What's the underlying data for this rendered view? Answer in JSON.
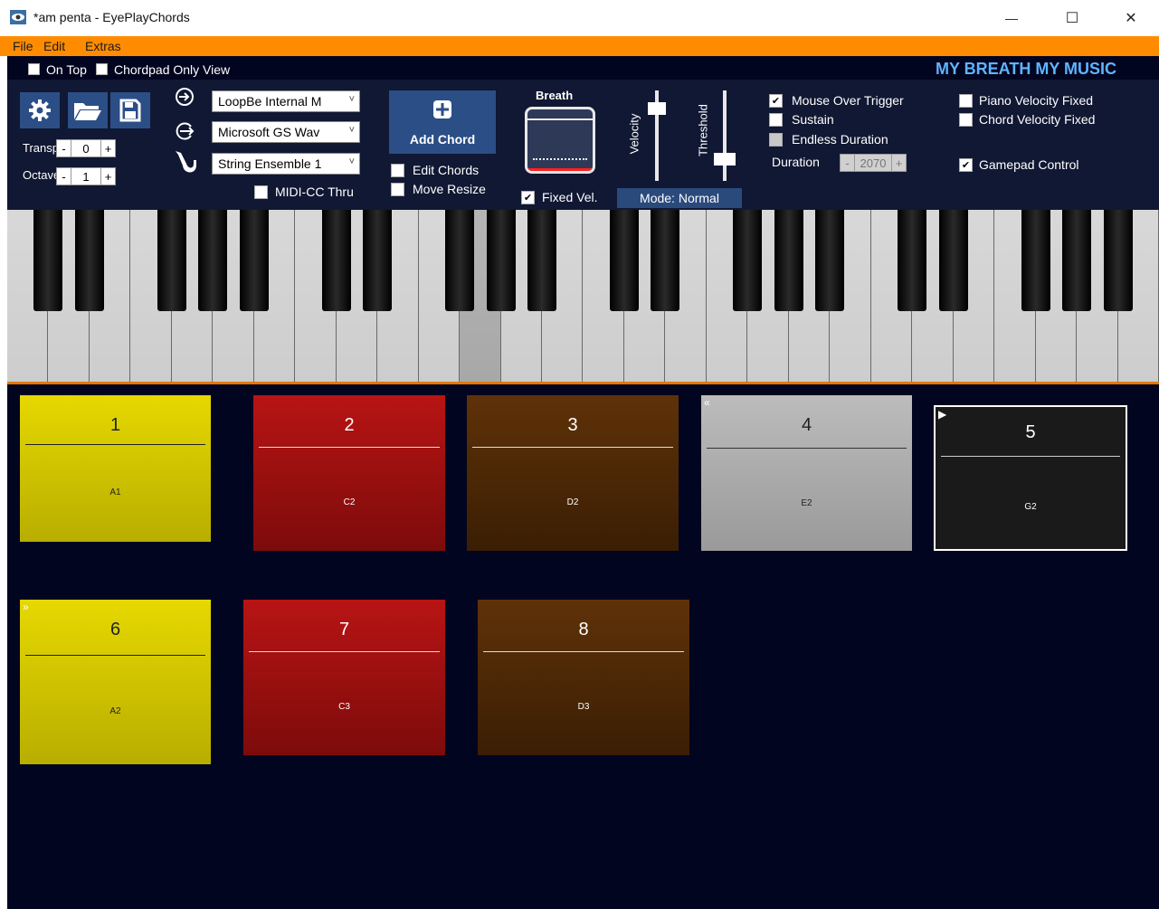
{
  "window": {
    "title": "*am penta  - EyePlayChords",
    "controls": [
      "—",
      "☐",
      "✕"
    ]
  },
  "menu": [
    "File",
    "Edit",
    "Extras"
  ],
  "topbar": {
    "on_top": "On Top",
    "chordpad_only": "Chordpad Only View",
    "slogan": "MY BREATH MY MUSIC"
  },
  "toolbar": {
    "transpose_label": "Transp",
    "transpose_value": "0",
    "octave_label": "Octave",
    "octave_value": "1",
    "minus": "-",
    "plus": "+",
    "midi_in": "LoopBe Internal M",
    "midi_out": "Microsoft GS Wav",
    "instrument": "String Ensemble 1",
    "midi_cc_thru": "MIDI-CC Thru",
    "add_chord": "Add Chord",
    "edit_chords": "Edit Chords",
    "move_resize": "Move Resize",
    "breath_label": "Breath",
    "breath_level": 0.1,
    "fixed_vel": "Fixed Vel.",
    "mode": "Mode: Normal",
    "velocity_label": "Velocity",
    "velocity_value": 0.85,
    "threshold_label": "Threshold",
    "threshold_value": 0.2,
    "mouse_over_trigger": "Mouse Over Trigger",
    "sustain": "Sustain",
    "endless_duration": "Endless Duration",
    "duration_label": "Duration",
    "duration_value": "2070",
    "piano_velocity_fixed": "Piano Velocity Fixed",
    "chord_velocity_fixed": "Chord Velocity Fixed",
    "gamepad_control": "Gamepad Control",
    "check_mark": "✔"
  },
  "colors": {
    "menu_bg": "#ff8c00",
    "dark_bg": "#02051f",
    "toolbar_bg": "#101833",
    "button_blue": "#2c4e86",
    "slogan": "#5fb4ff"
  },
  "pads": [
    {
      "number": "1",
      "note": "A1",
      "color": "yellow",
      "mark": ""
    },
    {
      "number": "2",
      "note": "C2",
      "color": "red",
      "mark": ""
    },
    {
      "number": "3",
      "note": "D2",
      "color": "brown",
      "mark": ""
    },
    {
      "number": "4",
      "note": "E2",
      "color": "gray",
      "mark": "«"
    },
    {
      "number": "5",
      "note": "G2",
      "color": "black",
      "mark": "▶"
    },
    {
      "number": "6",
      "note": "A2",
      "color": "yellow",
      "mark": "»"
    },
    {
      "number": "7",
      "note": "C3",
      "color": "red",
      "mark": ""
    },
    {
      "number": "8",
      "note": "D3",
      "color": "brown",
      "mark": ""
    }
  ]
}
